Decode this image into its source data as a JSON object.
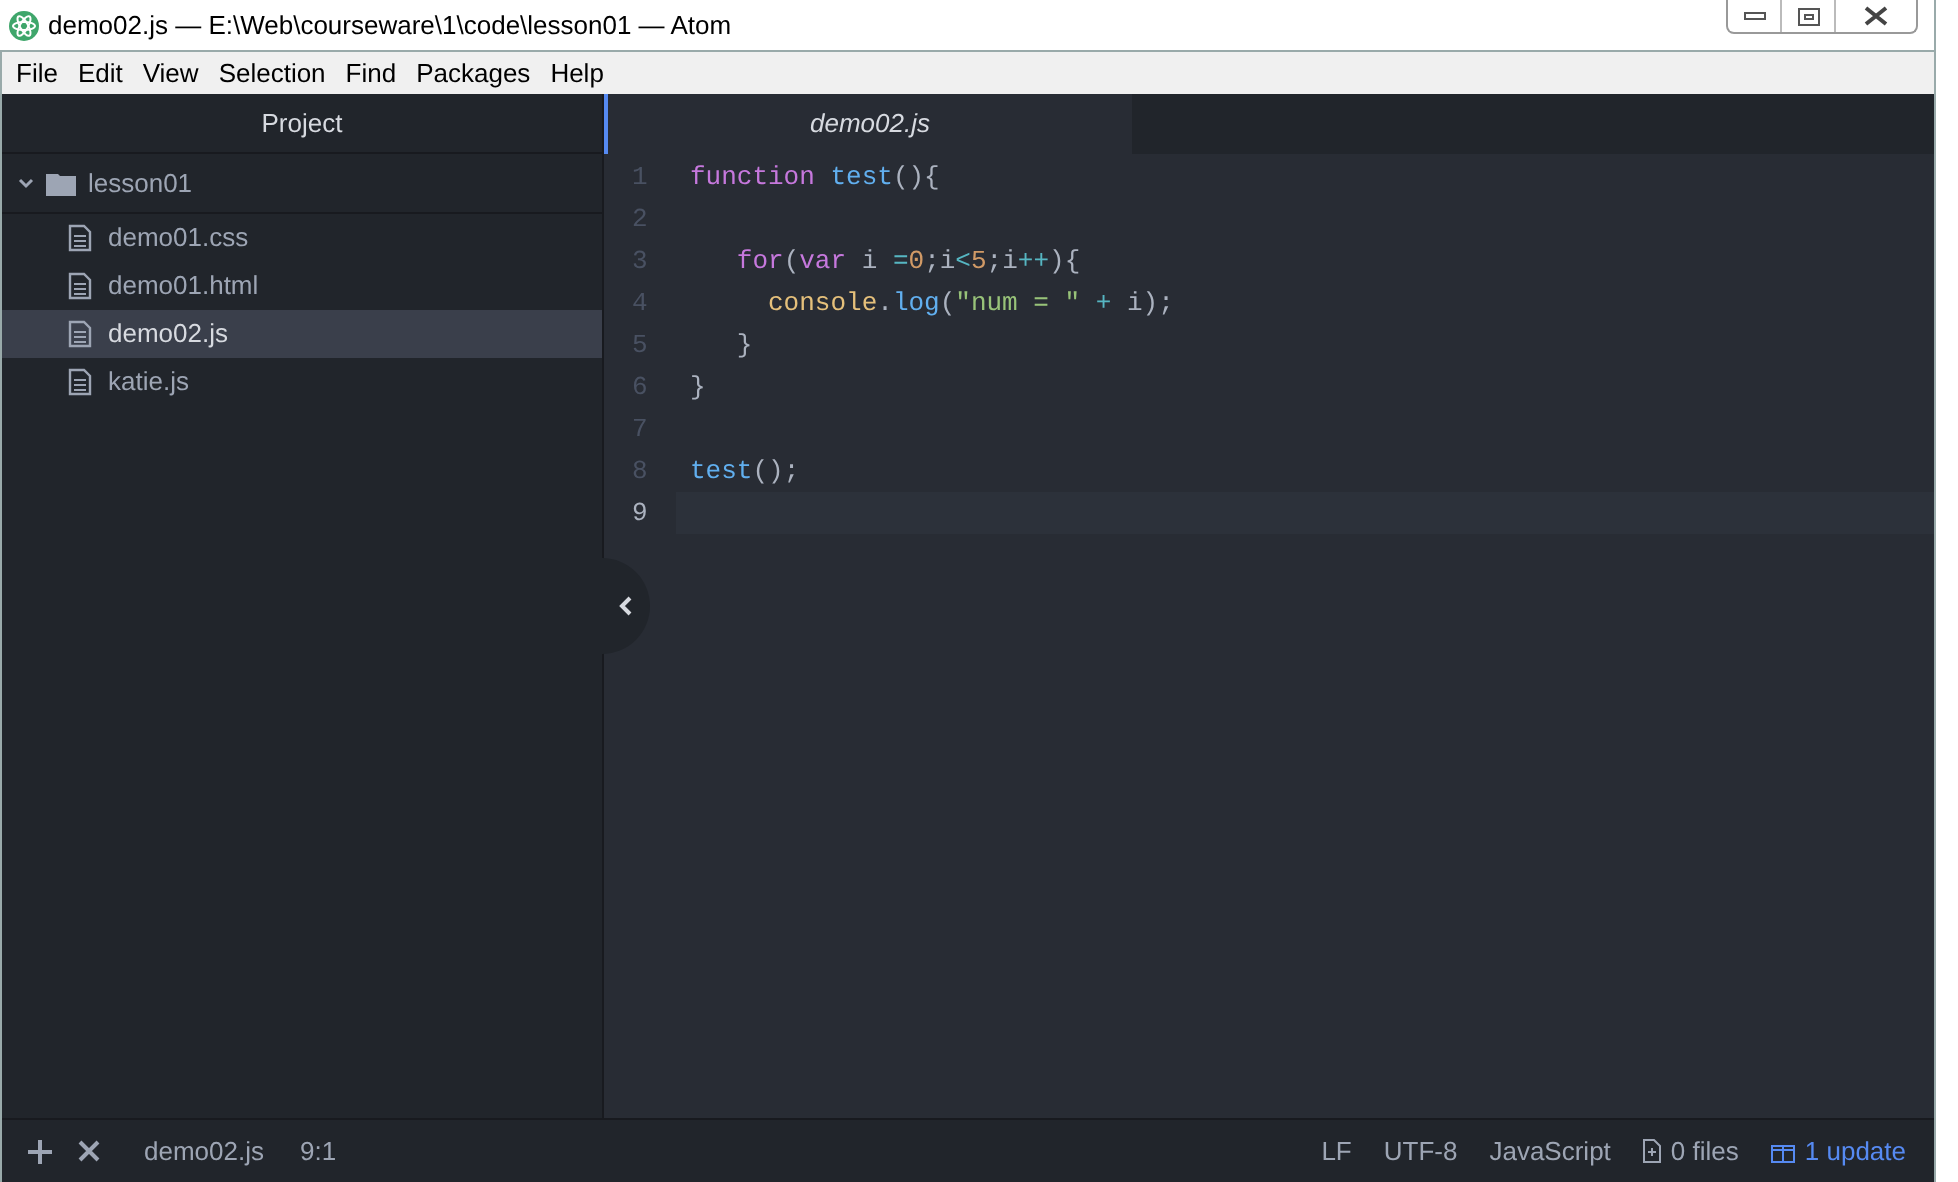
{
  "window": {
    "title": "demo02.js — E:\\Web\\courseware\\1\\code\\lesson01 — Atom"
  },
  "menu": [
    "File",
    "Edit",
    "View",
    "Selection",
    "Find",
    "Packages",
    "Help"
  ],
  "sidebar": {
    "title": "Project",
    "folder": {
      "name": "lesson01",
      "expanded": true,
      "children": [
        {
          "name": "demo01.css",
          "selected": false
        },
        {
          "name": "demo01.html",
          "selected": false
        },
        {
          "name": "demo02.js",
          "selected": true
        },
        {
          "name": "katie.js",
          "selected": false
        }
      ]
    }
  },
  "tabs": [
    {
      "label": "demo02.js",
      "selected": true
    }
  ],
  "editor": {
    "lines": [
      {
        "number": "1",
        "current": false,
        "tokens": [
          {
            "kind": "keyword",
            "text": "function"
          },
          {
            "kind": "function",
            "text": " test"
          },
          {
            "kind": "plain",
            "text": "(){"
          }
        ]
      },
      {
        "number": "2",
        "current": false
      },
      {
        "number": "3",
        "current": false,
        "tokens": [
          {
            "kind": "keyword",
            "text": "   for"
          },
          {
            "kind": "plain",
            "text": "("
          },
          {
            "kind": "keyword",
            "text": "var"
          },
          {
            "kind": "plain",
            "text": " i "
          },
          {
            "kind": "operator",
            "text": "="
          },
          {
            "kind": "number",
            "text": "0"
          },
          {
            "kind": "plain",
            "text": ";i"
          },
          {
            "kind": "operator",
            "text": "<"
          },
          {
            "kind": "number",
            "text": "5"
          },
          {
            "kind": "plain",
            "text": ";i"
          },
          {
            "kind": "operator",
            "text": "++"
          },
          {
            "kind": "plain",
            "text": "){"
          }
        ]
      },
      {
        "number": "4",
        "current": false,
        "tokens": [
          {
            "kind": "object",
            "text": "     console"
          },
          {
            "kind": "plain",
            "text": "."
          },
          {
            "kind": "function",
            "text": "log"
          },
          {
            "kind": "plain",
            "text": "("
          },
          {
            "kind": "string",
            "text": "\"num = \""
          },
          {
            "kind": "operator",
            "text": " +"
          },
          {
            "kind": "plain",
            "text": " i);"
          }
        ]
      },
      {
        "number": "5",
        "current": false,
        "tokens": [
          {
            "kind": "plain",
            "text": "   }"
          }
        ]
      },
      {
        "number": "6",
        "current": false,
        "tokens": [
          {
            "kind": "plain",
            "text": "}"
          }
        ]
      },
      {
        "number": "7",
        "current": false
      },
      {
        "number": "8",
        "current": false,
        "tokens": [
          {
            "kind": "function",
            "text": "test"
          },
          {
            "kind": "plain",
            "text": "();"
          }
        ]
      },
      {
        "number": "9",
        "current": true
      }
    ]
  },
  "status_bar": {
    "file": "demo02.js",
    "cursor": "9:1",
    "line_ending": "LF",
    "encoding": "UTF-8",
    "grammar": "JavaScript",
    "git": "0 files",
    "update": "1 update"
  }
}
